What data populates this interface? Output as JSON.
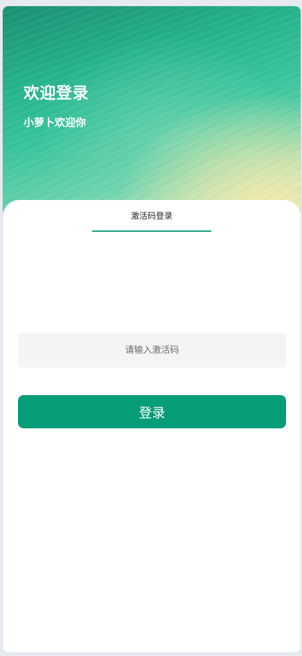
{
  "header": {
    "title": "欢迎登录",
    "subtitle": "小萝卜欢迎你"
  },
  "tabs": [
    {
      "label": "激活码登录",
      "active": true
    }
  ],
  "form": {
    "activation_code": {
      "value": "",
      "placeholder": "请输入激活码"
    },
    "login_label": "登录"
  },
  "colors": {
    "accent": "#069d79",
    "tab_underline": "#129a7a",
    "input_background": "#f4f4f4",
    "hero_gradient_start": "#1a8f74",
    "hero_gradient_end": "#efeab0"
  }
}
